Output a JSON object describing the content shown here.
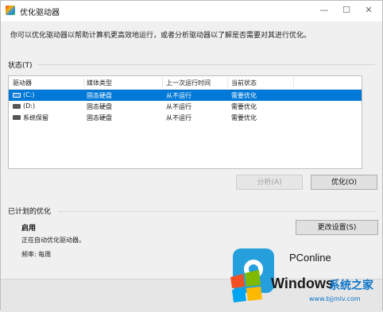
{
  "window": {
    "title": "优化驱动器",
    "controls": {
      "minimize": "—",
      "maximize": "☐",
      "close": "✕"
    }
  },
  "description": "你可以优化驱动器以帮助计算机更高效地运行，或者分析驱动器以了解是否需要对其进行优化。",
  "status_section": {
    "label": "状态(T)",
    "columns": [
      "驱动器",
      "媒体类型",
      "上一次运行时间",
      "当前状态"
    ],
    "rows": [
      {
        "drive": "(C:)",
        "media": "固态硬盘",
        "last_run": "从不运行",
        "status": "需要优化",
        "selected": true
      },
      {
        "drive": "(D:)",
        "media": "固态硬盘",
        "last_run": "从不运行",
        "status": "需要优化",
        "selected": false
      },
      {
        "drive": "系统保留",
        "media": "固态硬盘",
        "last_run": "从不运行",
        "status": "需要优化",
        "selected": false
      }
    ],
    "analyze_button": "分析(A)",
    "optimize_button": "优化(O)"
  },
  "schedule_section": {
    "label": "已计划的优化",
    "enabled": "启用",
    "status_text": "正在自动优化驱动器。",
    "frequency_text": "频率: 每周",
    "change_settings_button": "更改设置(S)"
  },
  "watermark": {
    "pconline": "PConline",
    "windows": "Windows",
    "cn_site": "系统之家",
    "url": "www.bjjmlv.com"
  },
  "colors": {
    "selection": "#0078d7",
    "brand_blue": "#25a0dd"
  }
}
